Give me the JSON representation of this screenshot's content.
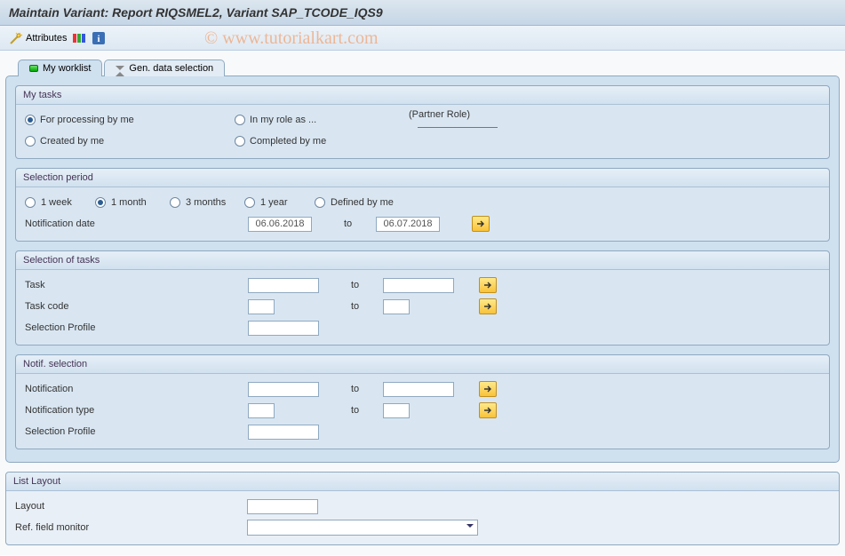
{
  "titlebar": "Maintain Variant: Report RIQSMEL2, Variant SAP_TCODE_IQS9",
  "watermark": "© www.tutorialkart.com",
  "toolbar": {
    "attributes": "Attributes"
  },
  "tabs": {
    "worklist": "My worklist",
    "gendata": "Gen. data selection"
  },
  "mytasks": {
    "title": "My tasks",
    "for_processing": "For processing by me",
    "in_my_role": "In my role as ...",
    "partner_role": "(Partner Role)",
    "created_by_me": "Created by me",
    "completed_by_me": "Completed by me"
  },
  "period": {
    "title": "Selection period",
    "w1": "1 week",
    "m1": "1 month",
    "m3": "3 months",
    "y1": "1 year",
    "defined": "Defined by me",
    "notif_date": "Notification date",
    "from": "06.06.2018",
    "to_lbl": "to",
    "to": "06.07.2018"
  },
  "seltasks": {
    "title": "Selection of tasks",
    "task": "Task",
    "task_code": "Task code",
    "sel_profile": "Selection Profile",
    "to_lbl": "to"
  },
  "notifsel": {
    "title": "Notif. selection",
    "notification": "Notification",
    "notif_type": "Notification type",
    "sel_profile": "Selection Profile",
    "to_lbl": "to"
  },
  "layout": {
    "title": "List Layout",
    "layout": "Layout",
    "ref_monitor": "Ref. field monitor"
  }
}
